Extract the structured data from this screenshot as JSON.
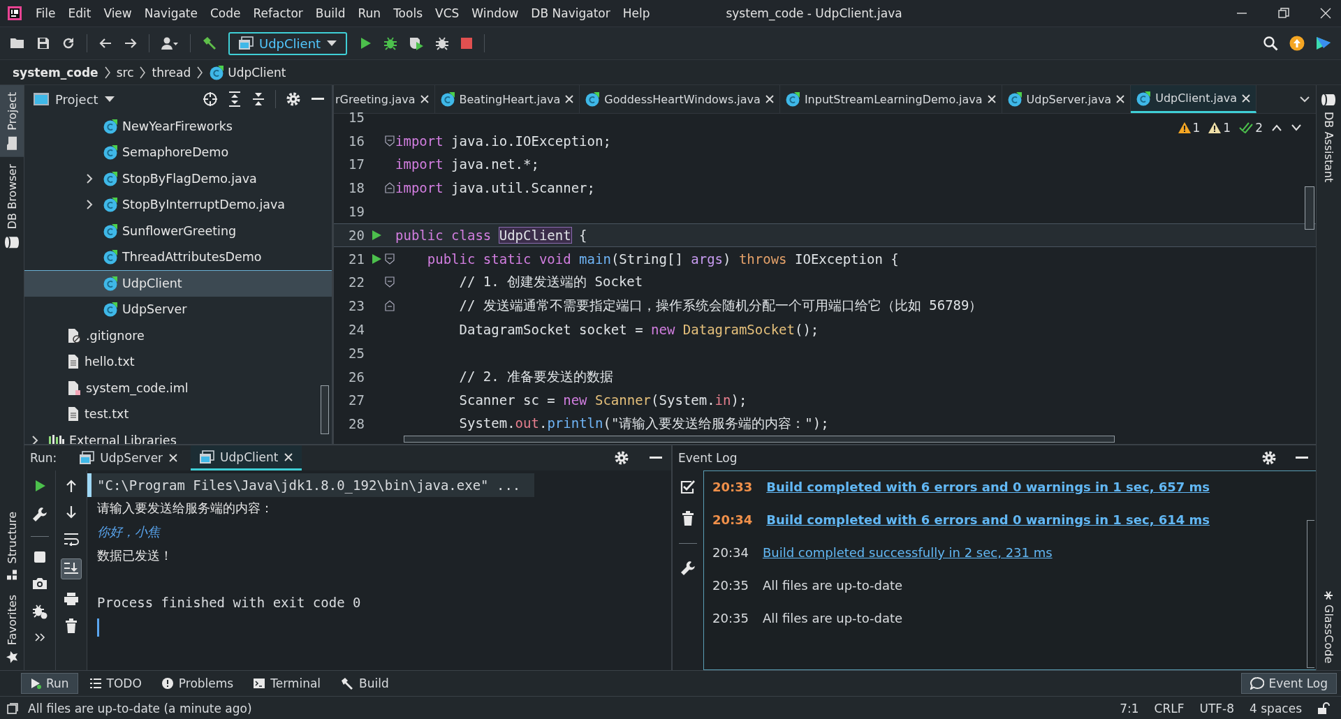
{
  "window": {
    "title": "system_code - UdpClient.java"
  },
  "menu": [
    "File",
    "Edit",
    "View",
    "Navigate",
    "Code",
    "Refactor",
    "Build",
    "Run",
    "Tools",
    "VCS",
    "Window",
    "DB Navigator",
    "Help"
  ],
  "toolbar": {
    "run_configuration": "UdpClient"
  },
  "breadcrumb": [
    "system_code",
    "src",
    "thread",
    "UdpClient"
  ],
  "left_tool_windows": [
    {
      "label": "Project",
      "selected": true
    },
    {
      "label": "DB Browser",
      "selected": false
    }
  ],
  "left_bottom_tool_windows": [
    {
      "label": "Structure"
    },
    {
      "label": "Favorites"
    }
  ],
  "right_tool_windows": [
    {
      "label": "DB Assistant"
    },
    {
      "label": "GlassCode"
    }
  ],
  "project": {
    "title": "Project",
    "tree": [
      {
        "children": [
          {
            "children": [
              {
                "children": [
                  {
                    "name": "NewYearFireworks",
                    "kind": "class",
                    "selected": false
                  },
                  {
                    "name": "SemaphoreDemo",
                    "kind": "class",
                    "selected": false
                  },
                  {
                    "name": "StopByFlagDemo.java",
                    "kind": "class",
                    "selected": false,
                    "expanded": false
                  },
                  {
                    "name": "StopByInterruptDemo.java",
                    "kind": "class",
                    "selected": false,
                    "expanded": false
                  },
                  {
                    "name": "SunflowerGreeting",
                    "kind": "class",
                    "selected": false
                  },
                  {
                    "name": "ThreadAttributesDemo",
                    "kind": "class",
                    "selected": false
                  },
                  {
                    "name": "UdpClient",
                    "kind": "class",
                    "selected": true
                  },
                  {
                    "name": "UdpServer",
                    "kind": "class",
                    "selected": false
                  }
                ]
              }
            ]
          },
          {
            "name": ".gitignore",
            "kind": "ignore",
            "selected": false
          },
          {
            "name": "hello.txt",
            "kind": "text",
            "selected": false
          },
          {
            "name": "system_code.iml",
            "kind": "module",
            "selected": false
          },
          {
            "name": "test.txt",
            "kind": "text",
            "selected": false
          }
        ]
      },
      {
        "name": "External Libraries",
        "kind": "library",
        "selected": false,
        "expanded": false
      }
    ]
  },
  "editor_tabs": [
    {
      "label": "rGreeting.java",
      "selected": false
    },
    {
      "label": "BeatingHeart.java",
      "selected": false
    },
    {
      "label": "GoddessHeartWindows.java",
      "selected": false
    },
    {
      "label": "InputStreamLearningDemo.java",
      "selected": false
    },
    {
      "label": "UdpServer.java",
      "selected": false
    },
    {
      "label": "UdpClient.java",
      "selected": true
    }
  ],
  "inspections": [
    {
      "kind": "warning",
      "count": "1"
    },
    {
      "kind": "weak",
      "count": "1"
    },
    {
      "kind": "ok",
      "count": "2"
    }
  ],
  "code": [
    {
      "number": "15",
      "current": false,
      "run": false
    },
    {
      "number": "16",
      "fold_open": true,
      "tokens": [
        {
          "t": "import",
          "kind": "kw"
        },
        {
          "t": " java.io.IOException;",
          "kind": "plain"
        }
      ],
      "current": false,
      "run": false
    },
    {
      "number": "17",
      "tokens": [
        {
          "t": "import",
          "kind": "kw"
        },
        {
          "t": " java.net.*;",
          "kind": "plain"
        }
      ],
      "current": false,
      "run": false
    },
    {
      "number": "18",
      "fold_close": true,
      "tokens": [
        {
          "t": "import",
          "kind": "kw"
        },
        {
          "t": " java.util.Scanner;",
          "kind": "plain"
        }
      ],
      "current": false,
      "run": false
    },
    {
      "number": "19",
      "current": false,
      "run": false
    },
    {
      "number": "20",
      "run": true,
      "tokens": [
        {
          "t": "public class ",
          "kind": "kw"
        },
        {
          "t": "UdpClient",
          "kind": "hl"
        },
        {
          "t": " {",
          "kind": "plain"
        }
      ],
      "current": true
    },
    {
      "number": "21",
      "run": true,
      "fold_open": true,
      "tokens": [
        {
          "t": "    public static void ",
          "kind": "kw"
        },
        {
          "t": "main",
          "kind": "fn"
        },
        {
          "t": "(String[] ",
          "kind": "plain"
        },
        {
          "t": "args",
          "kind": "param"
        },
        {
          "t": ") ",
          "kind": "plain"
        },
        {
          "t": "throws",
          "kind": "thr"
        },
        {
          "t": " IOException {",
          "kind": "plain"
        }
      ],
      "current": false
    },
    {
      "number": "22",
      "fold_open": true,
      "tokens": [
        {
          "t": "        // 1. 创建发送端的 Socket",
          "kind": "comment"
        }
      ],
      "current": false,
      "run": false
    },
    {
      "number": "23",
      "fold_close": true,
      "tokens": [
        {
          "t": "        // 发送端通常不需要指定端口，操作系统会随机分配一个可用端口给它（比如 56789）",
          "kind": "comment"
        }
      ],
      "current": false,
      "run": false
    },
    {
      "number": "24",
      "tokens": [
        {
          "t": "        DatagramSocket socket = ",
          "kind": "plain"
        },
        {
          "t": "new ",
          "kind": "kw"
        },
        {
          "t": "DatagramSocket",
          "kind": "cls"
        },
        {
          "t": "();",
          "kind": "plain"
        }
      ],
      "current": false,
      "run": false
    },
    {
      "number": "25",
      "current": false,
      "run": false
    },
    {
      "number": "26",
      "tokens": [
        {
          "t": "        // 2. 准备要发送的数据",
          "kind": "comment"
        }
      ],
      "current": false,
      "run": false
    },
    {
      "number": "27",
      "tokens": [
        {
          "t": "        Scanner sc = ",
          "kind": "plain"
        },
        {
          "t": "new ",
          "kind": "kw"
        },
        {
          "t": "Scanner",
          "kind": "cls"
        },
        {
          "t": "(System.",
          "kind": "plain"
        },
        {
          "t": "in",
          "kind": "field"
        },
        {
          "t": ");",
          "kind": "plain"
        }
      ],
      "current": false,
      "run": false
    },
    {
      "number": "28",
      "tokens": [
        {
          "t": "        System.",
          "kind": "plain"
        },
        {
          "t": "out",
          "kind": "field"
        },
        {
          "t": ".",
          "kind": "plain"
        },
        {
          "t": "println",
          "kind": "fn"
        },
        {
          "t": "(\"请输入要发送给服务端的内容：\");",
          "kind": "plain"
        }
      ],
      "current": false,
      "run": false
    }
  ],
  "run_panel": {
    "label": "Run:",
    "tabs": [
      {
        "label": "UdpServer",
        "selected": false
      },
      {
        "label": "UdpClient",
        "selected": true
      }
    ],
    "console": [
      {
        "text": "\"C:\\Program Files\\Java\\jdk1.8.0_192\\bin\\java.exe\" ...",
        "kind": "command"
      },
      {
        "text": "请输入要发送给服务端的内容：",
        "kind": "output"
      },
      {
        "text": "你好，小焦",
        "kind": "input"
      },
      {
        "text": "数据已发送！",
        "kind": "output"
      },
      {
        "text": "Process finished with exit code 0",
        "kind": "exit"
      }
    ]
  },
  "event_log": {
    "title": "Event Log",
    "entries": [
      {
        "time": "20:33",
        "message": "Build completed with 6 errors and 0 warnings in 1 sec, 657 ms",
        "kind": "error"
      },
      {
        "time": "20:34",
        "message": "Build completed with 6 errors and 0 warnings in 1 sec, 614 ms",
        "kind": "error"
      },
      {
        "time": "20:34",
        "message": "Build completed successfully in 2 sec, 231 ms",
        "kind": "success"
      },
      {
        "time": "20:35",
        "message": "All files are up-to-date",
        "kind": "info"
      },
      {
        "time": "20:35",
        "message": "All files are up-to-date",
        "kind": "info"
      }
    ]
  },
  "tool_tabs": [
    {
      "label": "Run",
      "kind": "run",
      "selected": true
    },
    {
      "label": "TODO",
      "kind": "todo",
      "selected": false
    },
    {
      "label": "Problems",
      "kind": "problems",
      "selected": false
    },
    {
      "label": "Terminal",
      "kind": "terminal",
      "selected": false
    },
    {
      "label": "Build",
      "kind": "build",
      "selected": false
    }
  ],
  "event_log_button": {
    "label": "Event Log",
    "selected": true
  },
  "status_bar": {
    "message": "All files are up-to-date (a minute ago)",
    "position": "7:1",
    "line_separator": "CRLF",
    "encoding": "UTF-8",
    "indent": "4 spaces"
  }
}
